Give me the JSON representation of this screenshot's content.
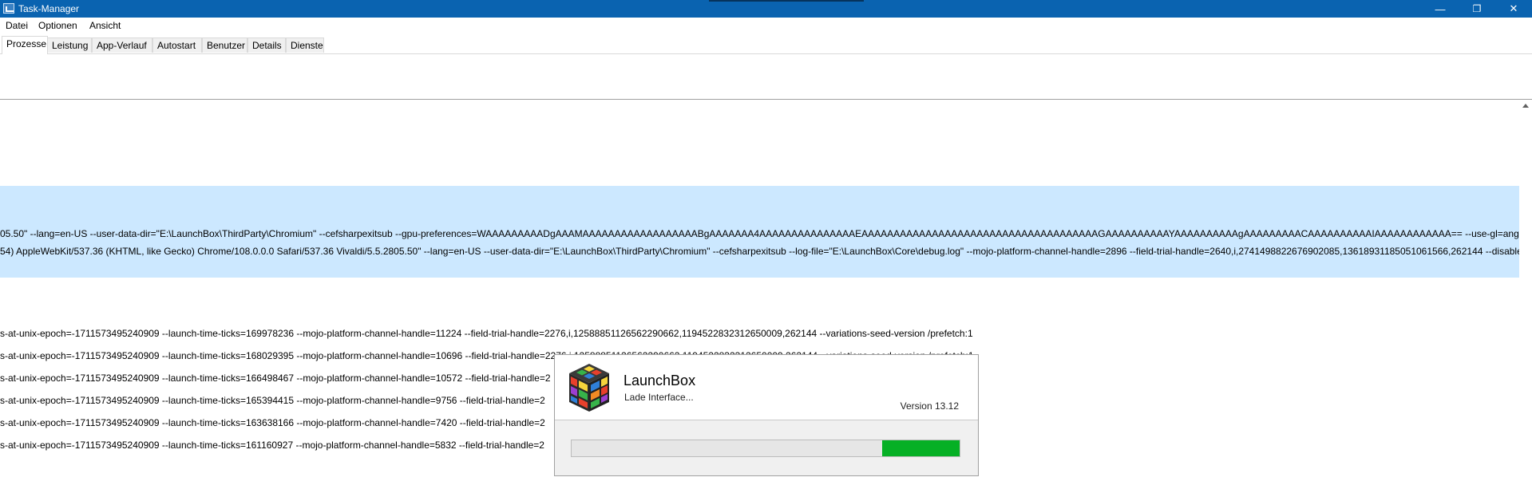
{
  "window": {
    "title": "Task-Manager",
    "buttons": {
      "minimize": "—",
      "restore": "❐",
      "close": "✕"
    }
  },
  "menu": [
    "Datei",
    "Optionen",
    "Ansicht"
  ],
  "tabs": [
    "Prozesse",
    "Leistung",
    "App-Verlauf",
    "Autostart",
    "Benutzer",
    "Details",
    "Dienste"
  ],
  "selected_rows": [
    "05.50\" --lang=en-US --user-data-dir=\"E:\\LaunchBox\\ThirdParty\\Chromium\" --cefsharpexitsub --gpu-preferences=WAAAAAAAAADgAAAMAAAAAAAAAAAAAAAAAABgAAAAAAA4AAAAAAAAAAAAAAAEAAAAAAAAAAAAAAAAAAAAAAAAAAAAAAAAAAAAAGAAAAAAAAAAYAAAAAAAAAAgAAAAAAAAACAAAAAAAAAAIAAAAAAAAAAAA== --use-gl=angle --",
    "54) AppleWebKit/537.36 (KHTML, like Gecko) Chrome/108.0.0.0 Safari/537.36 Vivaldi/5.5.2805.50\" --lang=en-US --user-data-dir=\"E:\\LaunchBox\\ThirdParty\\Chromium\" --cefsharpexitsub --log-file=\"E:\\LaunchBox\\Core\\debug.log\" --mojo-platform-channel-handle=2896 --field-trial-handle=2640,i,2741498822676902085,13618931185051061566,262144 --disable-fea"
  ],
  "rows": [
    "s-at-unix-epoch=-1711573495240909 --launch-time-ticks=169978236 --mojo-platform-channel-handle=11224 --field-trial-handle=2276,i,12588851126562290662,1194522832312650009,262144 --variations-seed-version /prefetch:1",
    "s-at-unix-epoch=-1711573495240909 --launch-time-ticks=168029395 --mojo-platform-channel-handle=10696 --field-trial-handle=2276,i,12588851126562290662,1194522832312650009,262144 --variations-seed-version /prefetch:1",
    "s-at-unix-epoch=-1711573495240909 --launch-time-ticks=166498467 --mojo-platform-channel-handle=10572 --field-trial-handle=2",
    "s-at-unix-epoch=-1711573495240909 --launch-time-ticks=165394415 --mojo-platform-channel-handle=9756 --field-trial-handle=2",
    "s-at-unix-epoch=-1711573495240909 --launch-time-ticks=163638166 --mojo-platform-channel-handle=7420 --field-trial-handle=2",
    "s-at-unix-epoch=-1711573495240909 --launch-time-ticks=161160927 --mojo-platform-channel-handle=5832 --field-trial-handle=2"
  ],
  "splash": {
    "app_name": "LaunchBox",
    "status": "Lade Interface...",
    "version": "Version 13.12",
    "progress": 0.2
  },
  "colors": {
    "titlebar": "#0a63b0",
    "selection": "#cce8ff",
    "progress_fill": "#06b025"
  }
}
